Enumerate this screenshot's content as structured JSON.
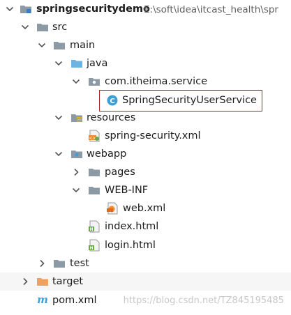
{
  "project": {
    "name": "springsecuritydemo",
    "path": "E:\\soft\\idea\\itcast_health\\spr"
  },
  "nodes": {
    "src": "src",
    "main": "main",
    "java": "java",
    "package": "com.itheima.service",
    "class_file": "SpringSecurityUserService",
    "resources": "resources",
    "spring_xml": "spring-security.xml",
    "webapp": "webapp",
    "pages": "pages",
    "webinf": "WEB-INF",
    "web_xml": "web.xml",
    "index_html": "index.html",
    "login_html": "login.html",
    "test": "test",
    "target": "target",
    "pom": "pom.xml"
  },
  "watermark": "https://blog.csdn.net/TZ845195485",
  "colors": {
    "folder": "#8c9aa6",
    "source_folder": "#6fb3e0",
    "excluded_folder": "#f0a15f",
    "selection_border": "#b0202a"
  }
}
